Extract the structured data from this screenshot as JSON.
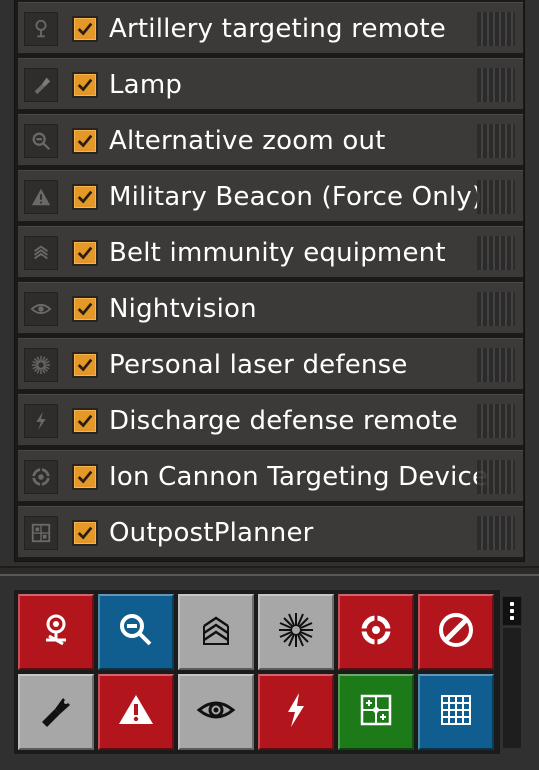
{
  "shortcuts": [
    {
      "label": "Artillery targeting remote",
      "icon": "artillery-remote-icon",
      "enabled": true
    },
    {
      "label": "Lamp",
      "icon": "flashlight-icon",
      "enabled": true
    },
    {
      "label": "Alternative zoom out",
      "icon": "zoom-out-icon",
      "enabled": true
    },
    {
      "label": "Military Beacon (Force Only)",
      "icon": "warning-icon",
      "enabled": true
    },
    {
      "label": "Belt immunity equipment",
      "icon": "belt-immunity-icon",
      "enabled": true
    },
    {
      "label": "Nightvision",
      "icon": "eye-icon",
      "enabled": true
    },
    {
      "label": "Personal laser defense",
      "icon": "laser-burst-icon",
      "enabled": true
    },
    {
      "label": "Discharge defense remote",
      "icon": "lightning-icon",
      "enabled": true
    },
    {
      "label": "Ion Cannon Targeting Device",
      "icon": "ion-cannon-icon",
      "enabled": true
    },
    {
      "label": "OutpostPlanner",
      "icon": "blueprint-icon",
      "enabled": true
    }
  ],
  "toolbar": [
    {
      "icon": "artillery-remote-icon",
      "color": "#b3151d"
    },
    {
      "icon": "zoom-out-icon",
      "color": "#0f5e8f"
    },
    {
      "icon": "belt-immunity-icon",
      "color": "#a7a7a7"
    },
    {
      "icon": "laser-burst-icon",
      "color": "#a7a7a7"
    },
    {
      "icon": "ion-cannon-icon",
      "color": "#b3151d"
    },
    {
      "icon": "no-entry-icon",
      "color": "#b3151d"
    },
    {
      "icon": "flashlight-icon",
      "color": "#a7a7a7"
    },
    {
      "icon": "warning-icon",
      "color": "#b3151d"
    },
    {
      "icon": "eye-icon",
      "color": "#a7a7a7"
    },
    {
      "icon": "lightning-icon",
      "color": "#b3151d"
    },
    {
      "icon": "blueprint-icon",
      "color": "#1c7a19"
    },
    {
      "icon": "grid-icon",
      "color": "#0f5e8f"
    }
  ],
  "colors": {
    "checkbox": "#e39827",
    "red": "#b3151d",
    "blue": "#0f5e8f",
    "grey": "#a7a7a7",
    "green": "#1c7a19"
  }
}
